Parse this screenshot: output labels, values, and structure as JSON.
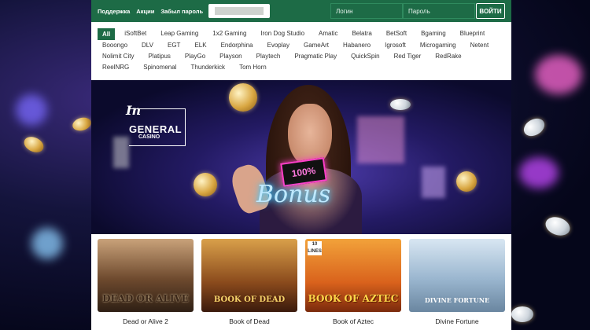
{
  "topbar": {
    "links": [
      "Поддержка",
      "Акции",
      "Забыл пароль"
    ],
    "login_placeholder": "Логин",
    "password_placeholder": "Пароль",
    "login_button": "ВОЙТИ",
    "color": "#1d6b46"
  },
  "providers": {
    "active": "All",
    "items": [
      "All",
      "iSoftBet",
      "Leap Gaming",
      "1x2 Gaming",
      "Iron Dog Studio",
      "Amatic",
      "Belatra",
      "BetSoft",
      "Bgaming",
      "Blueprint",
      "Booongo",
      "DLV",
      "EGT",
      "ELK",
      "Endorphina",
      "Evoplay",
      "GameArt",
      "Habanero",
      "Igrosoft",
      "Microgaming",
      "Netent",
      "Nolimit City",
      "Platipus",
      "PlayGo",
      "Playson",
      "Playtech",
      "Pragmatic Play",
      "QuickSpin",
      "Red Tiger",
      "RedRake",
      "ReelNRG",
      "Spinomenal",
      "Thunderkick",
      "Tom Horn"
    ]
  },
  "banner": {
    "logo_in": "In",
    "logo_general": "GENERAL",
    "logo_casino": "CASINO",
    "card_text": "100%",
    "bonus_text": "Bonus"
  },
  "games": [
    {
      "name": "Dead or Alive 2",
      "logo": "DEAD OR ALIVE"
    },
    {
      "name": "Book of Dead",
      "logo": "BOOK OF DEAD"
    },
    {
      "name": "Book of Aztec",
      "logo": "BOOK OF AZTEC"
    },
    {
      "name": "Divine Fortune",
      "logo": "DIVINE FORTUNE"
    }
  ]
}
